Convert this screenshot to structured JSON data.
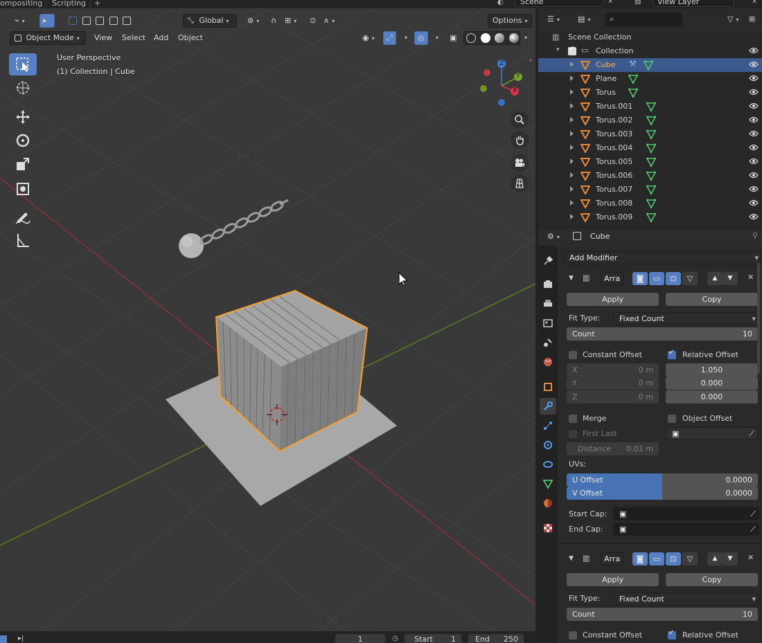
{
  "workspace_tabs": [
    "ompositing",
    "Scripting",
    "+"
  ],
  "scene_selector": {
    "label": "Scene",
    "view_layer": "View Layer"
  },
  "viewport_header": {
    "orientation": "Global",
    "options": "Options",
    "mode": "Object Mode",
    "menus": [
      "View",
      "Select",
      "Add",
      "Object"
    ]
  },
  "hud": {
    "perspective": "User Perspective",
    "context": "(1) Collection | Cube"
  },
  "gizmo_axes": {
    "x": "X",
    "y": "Y",
    "z": "Z"
  },
  "outliner": {
    "root": "Scene Collection",
    "collection": "Collection",
    "items": [
      {
        "name": "Cube",
        "selected": true
      },
      {
        "name": "Plane",
        "selected": false
      },
      {
        "name": "Torus",
        "selected": false
      },
      {
        "name": "Torus.001",
        "selected": false
      },
      {
        "name": "Torus.002",
        "selected": false
      },
      {
        "name": "Torus.003",
        "selected": false
      },
      {
        "name": "Torus.004",
        "selected": false
      },
      {
        "name": "Torus.005",
        "selected": false
      },
      {
        "name": "Torus.006",
        "selected": false
      },
      {
        "name": "Torus.007",
        "selected": false
      },
      {
        "name": "Torus.008",
        "selected": false
      },
      {
        "name": "Torus.009",
        "selected": false
      }
    ]
  },
  "properties": {
    "object_name": "Cube",
    "add_modifier": "Add Modifier",
    "modifier1": {
      "name": "Arra",
      "apply": "Apply",
      "copy": "Copy",
      "fit_type_label": "Fit Type:",
      "fit_type": "Fixed Count",
      "count_label": "Count",
      "count": "10",
      "constant_offset": "Constant Offset",
      "relative_offset": "Relative Offset",
      "const_x_label": "X",
      "const_x": "0 m",
      "const_y_label": "Y",
      "const_y": "0 m",
      "const_z_label": "Z",
      "const_z": "0 m",
      "rel_x": "1.050",
      "rel_y": "0.000",
      "rel_z": "0.000",
      "merge": "Merge",
      "object_offset": "Object Offset",
      "first_last": "First Last",
      "distance_label": "Distance",
      "distance": "0.01 m",
      "uvs": "UVs:",
      "u_offset_label": "U Offset",
      "u_offset": "0.0000",
      "v_offset_label": "V Offset",
      "v_offset": "0.0000",
      "start_cap": "Start Cap:",
      "end_cap": "End Cap:"
    },
    "modifier2": {
      "name": "Arra",
      "apply": "Apply",
      "copy": "Copy",
      "fit_type_label": "Fit Type:",
      "fit_type": "Fixed Count",
      "count_label": "Count",
      "count": "10",
      "constant_offset": "Constant Offset",
      "relative_offset": "Relative Offset"
    }
  },
  "timeline": {
    "frame": "1",
    "start_label": "Start",
    "start": "1",
    "end_label": "End",
    "end": "250"
  },
  "colors": {
    "accent": "#5680c2",
    "selection_outline": "#f5a030",
    "x_axis": "#d9364a",
    "y_axis": "#7aa12b",
    "z_axis": "#3f7fd6"
  }
}
